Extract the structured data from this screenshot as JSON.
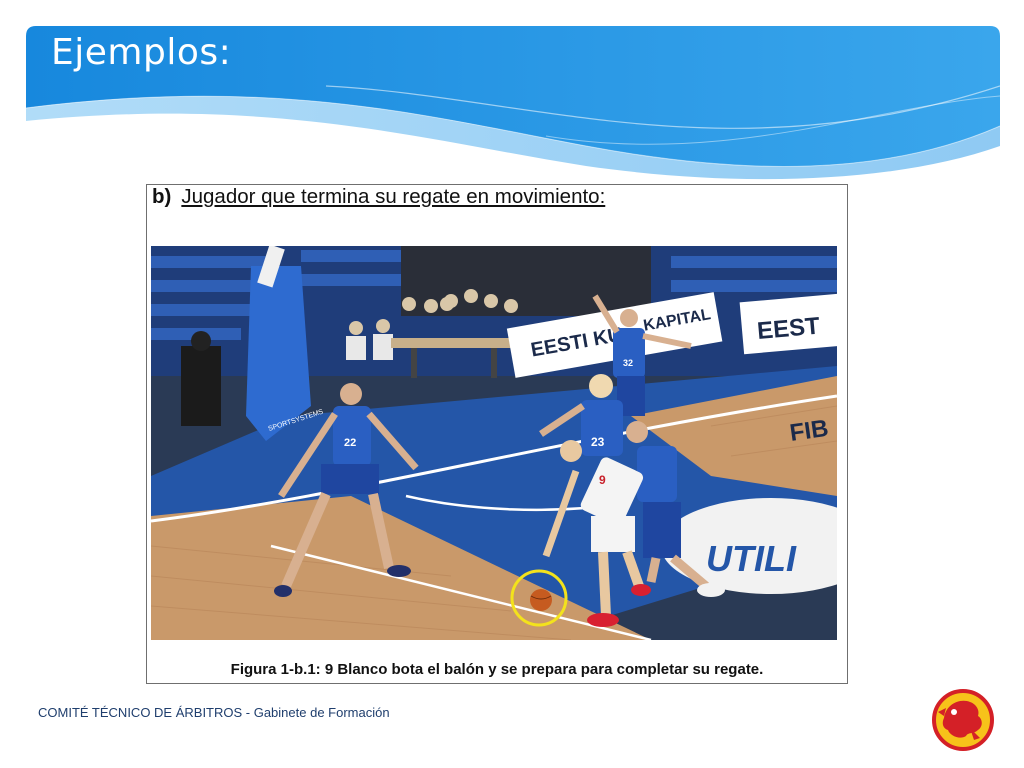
{
  "slide": {
    "title": "Ejemplos:"
  },
  "figure": {
    "heading_letter": "b)",
    "heading_text": "Jugador que termina su regate en movimiento:",
    "caption": "Figura 1-b.1: 9 Blanco bota el balón y se prepara para completar su regate.",
    "photo_signs": {
      "ad_left": "EESTI KU",
      "ad_left_end": "KAPITAL",
      "ad_right": "EEST",
      "floor_logo": "UTILI",
      "floor_side": "FIB",
      "stanchion": "SPORTSYSTEMS",
      "jersey_left": "22",
      "jersey_center": "23",
      "jersey_back": "32",
      "jersey_white": "9"
    }
  },
  "footer": {
    "text": "COMITÉ TÉCNICO DE ÁRBITROS - Gabinete de Formación"
  },
  "colors": {
    "banner_blue": "#1f8ee0",
    "banner_light": "#64b8f0",
    "court_blue": "#2456a8",
    "court_wood": "#c9996a",
    "highlight_circle": "#f3e21c",
    "logo_red": "#d42027",
    "logo_yellow": "#f7c21a"
  },
  "icons": {
    "footer_logo": "referee-committee-logo-icon"
  }
}
